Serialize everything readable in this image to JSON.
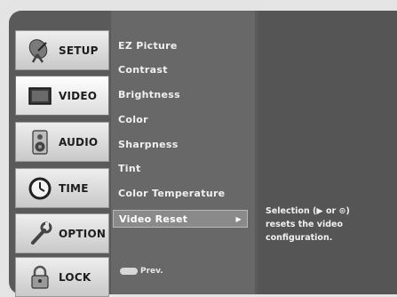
{
  "sidebar": {
    "items": [
      {
        "label": "SETUP",
        "icon": "satellite-dish-icon"
      },
      {
        "label": "VIDEO",
        "icon": "tv-screen-icon"
      },
      {
        "label": "AUDIO",
        "icon": "speaker-icon"
      },
      {
        "label": "TIME",
        "icon": "clock-icon"
      },
      {
        "label": "OPTION",
        "icon": "wrench-icon"
      },
      {
        "label": "LOCK",
        "icon": "padlock-icon"
      }
    ],
    "active": "VIDEO"
  },
  "menu": {
    "items": [
      "EZ Picture",
      "Contrast",
      "Brightness",
      "Color",
      "Sharpness",
      "Tint",
      "Color Temperature",
      "Video Reset"
    ],
    "selected": "Video Reset",
    "selected_arrow": "▶",
    "prev_label": "Prev."
  },
  "info": {
    "text": "Selection (▶ or ⊙)\nresets the video\nconfiguration."
  },
  "colors": {
    "osd_background": "#5a5a5a",
    "menu_panel": "#686868",
    "selected_item": "#8a8a8a",
    "sidebar_button": "#dcdcdc"
  }
}
